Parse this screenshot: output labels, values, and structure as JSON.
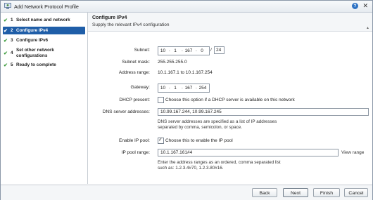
{
  "window": {
    "title": "Add Network Protocol Profile",
    "help_label": "?",
    "close_label": "✕"
  },
  "sidebar": {
    "items": [
      {
        "number": "1",
        "label": "Select name and network",
        "done": true,
        "check": "✔"
      },
      {
        "number": "2",
        "label": "Configure IPv4",
        "done": true,
        "check": "✔",
        "active": true
      },
      {
        "number": "3",
        "label": "Configure IPv6",
        "done": true,
        "check": "✔"
      },
      {
        "number": "4",
        "label_line1": "Set other network",
        "label_line2": "configurations",
        "done": true,
        "check": "✔"
      },
      {
        "number": "5",
        "label": "Ready to complete",
        "done": true,
        "check": "✔"
      }
    ]
  },
  "header": {
    "title": "Configure IPv4",
    "subtitle": "Supply the relevant IPv4 configuration"
  },
  "form": {
    "subnet": {
      "label": "Subnet:",
      "octets": [
        "10",
        "1",
        "167",
        "0"
      ],
      "separator": "/",
      "prefix": "24"
    },
    "subnet_mask": {
      "label": "Subnet mask:",
      "value": "255.255.255.0"
    },
    "address_range": {
      "label": "Address range:",
      "value": "10.1.167.1 to 10.1.167.254"
    },
    "gateway": {
      "label": "Gateway:",
      "octets": [
        "10",
        "1",
        "167",
        "254"
      ]
    },
    "dhcp": {
      "label": "DHCP present:",
      "checked": false,
      "text": "Choose this option if a DHCP server is available on this network"
    },
    "dns": {
      "label": "DNS server addresses:",
      "value": "10.99.167.244, 10.99.167.245",
      "hint_line1": "DNS server addresses are specified as a list of IP addresses",
      "hint_line2": "separated by comma, semicolon, or space."
    },
    "ip_pool_enable": {
      "label": "Enable IP pool:",
      "checked": true,
      "text": "Choose this to enable the IP pool"
    },
    "ip_pool_range": {
      "label": "IP pool range:",
      "value": "10.1.167.161#4",
      "view_range": "View range",
      "hint_line1": "Enter the address ranges as an ordered, comma separated list",
      "hint_line2": "such as: 1.2.3.4#70, 1.2.3.80#16."
    }
  },
  "footer": {
    "back": "Back",
    "next": "Next",
    "finish": "Finish",
    "cancel": "Cancel"
  },
  "colors": {
    "accent": "#1f5ea8",
    "check": "#3a9a3a",
    "help": "#2e72c4"
  }
}
